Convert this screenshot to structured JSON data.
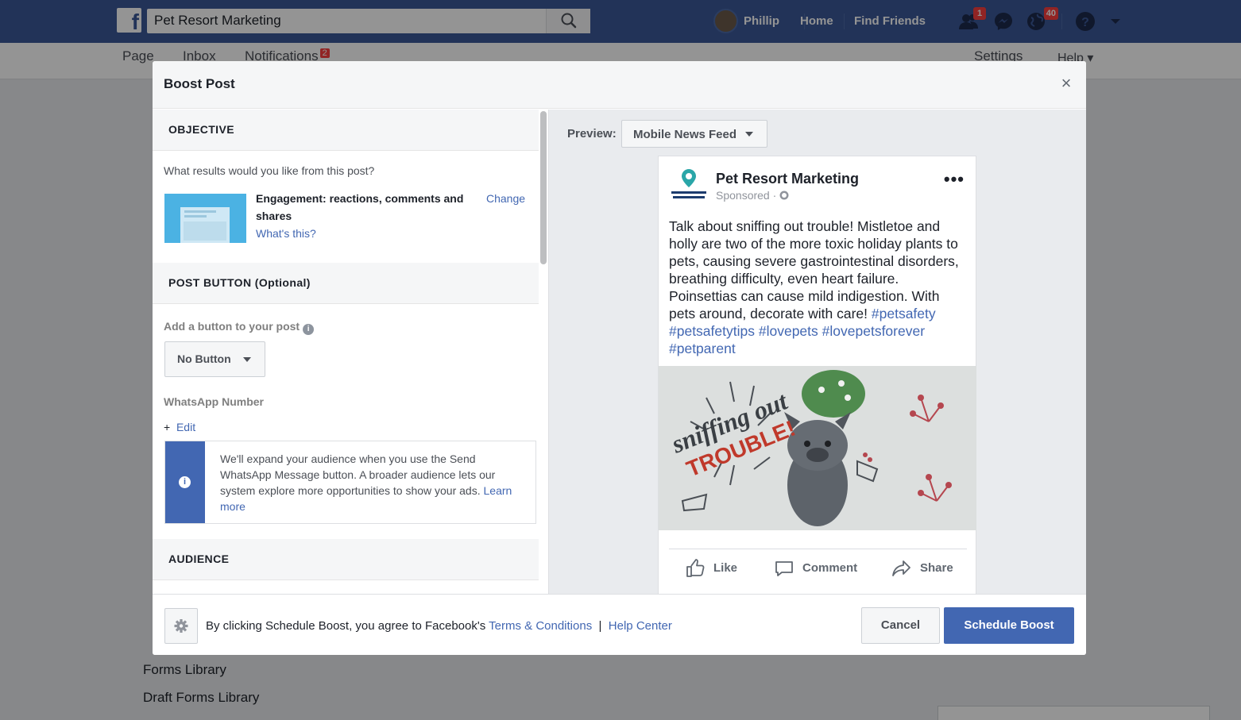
{
  "topbar": {
    "search_value": "Pet Resort Marketing",
    "user_name": "Phillip",
    "home": "Home",
    "find_friends": "Find Friends",
    "friend_requests_badge": "1",
    "notifications_badge": "40"
  },
  "subnav": {
    "page": "Page",
    "inbox": "Inbox",
    "notifications": "Notifications",
    "notifications_badge": "2",
    "settings": "Settings",
    "help": "Help ▾"
  },
  "background_sidebar": {
    "forms_library": "Forms Library",
    "draft_forms_library": "Draft Forms Library"
  },
  "dialog": {
    "title": "Boost Post",
    "objective": {
      "heading": "OBJECTIVE",
      "question": "What results would you like from this post?",
      "selected": "Engagement: reactions, comments and shares",
      "whats_this": "What's this?",
      "change": "Change"
    },
    "post_button": {
      "heading": "POST BUTTON (Optional)",
      "add_label": "Add a button to your post",
      "dropdown_value": "No Button",
      "whatsapp_label": "WhatsApp Number",
      "edit_prefix": "+",
      "edit": "Edit",
      "info_text": "We'll expand your audience when you use the Send WhatsApp Message button. A broader audience lets our system explore more opportunities to show your ads.",
      "learn_more": "Learn more"
    },
    "audience": {
      "heading": "AUDIENCE"
    },
    "preview": {
      "label": "Preview:",
      "placement": "Mobile News Feed",
      "post": {
        "page_name": "Pet Resort Marketing",
        "sponsored": "Sponsored ·",
        "text": "Talk about sniffing out trouble! Mistletoe and holly are two of the more toxic holiday plants to pets, causing severe gastrointestinal disorders, breathing difficulty, even heart failure. Poinsettias can cause mild indigestion. With pets around, decorate with care!",
        "hashtags": [
          "#petsafety",
          "#petsafetytips",
          "#lovepets",
          "#lovepetsforever",
          "#petparent"
        ],
        "image_text_line1": "sniffing out",
        "image_text_line2": "TROUBLE!",
        "actions": {
          "like": "Like",
          "comment": "Comment",
          "share": "Share"
        }
      }
    },
    "footer": {
      "agree_text": "By clicking Schedule Boost, you agree to Facebook's",
      "terms": "Terms & Conditions",
      "divider": "|",
      "help_center": "Help Center",
      "cancel": "Cancel",
      "schedule": "Schedule Boost"
    }
  },
  "colors": {
    "facebook_blue": "#3b5998",
    "primary_button": "#4267b2",
    "link": "#4267b2",
    "badge_red": "#fa3e3e"
  }
}
